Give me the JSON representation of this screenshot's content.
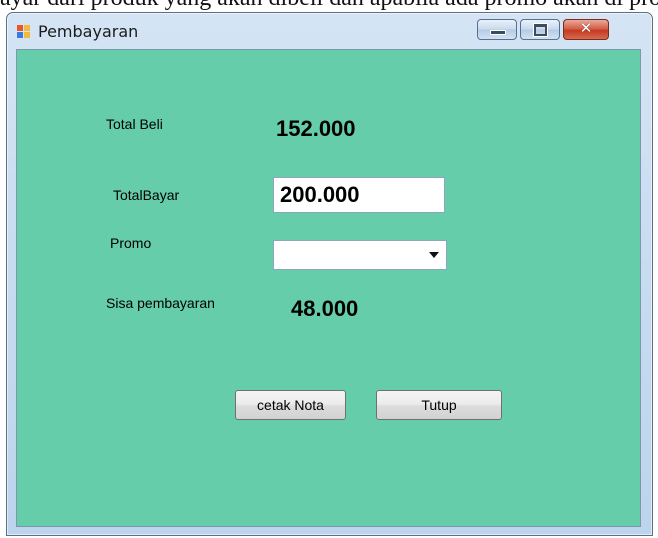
{
  "background_text": "ayar dari produk yang akan dibeli dan apabila ada promo akan di pro",
  "window": {
    "title": "Pembayaran",
    "controls": {
      "minimize": "minimize-icon",
      "maximize": "maximize-icon",
      "close": "✕"
    }
  },
  "form": {
    "total_beli_label": "Total Beli",
    "total_beli_value": "152.000",
    "total_bayar_label": "TotalBayar",
    "total_bayar_value": "200.000",
    "promo_label": "Promo",
    "promo_value": "",
    "sisa_label": "Sisa pembayaran",
    "sisa_value": "48.000"
  },
  "buttons": {
    "cetak_nota": "cetak Nota",
    "tutup": "Tutup"
  },
  "colors": {
    "client_bg": "#66cdaa",
    "close_button": "#c43a22"
  }
}
